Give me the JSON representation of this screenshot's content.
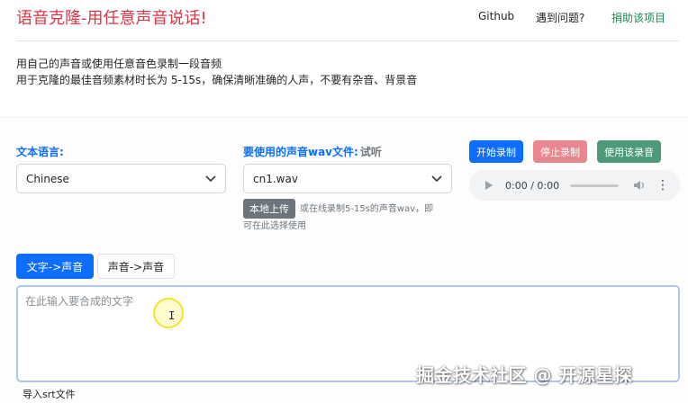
{
  "header": {
    "brand": "语音克隆-用任意声音说话!",
    "nav": {
      "github": "Github",
      "issue": "遇到问题?",
      "donate": "捐助该项目"
    }
  },
  "intro": {
    "line1": "用自己的声音或使用任意音色录制一段音频",
    "line2": "用于克隆的最佳音频素材时长为 5-15s，确保清晰准确的人声，不要有杂音、背景音"
  },
  "form": {
    "language_label": "文本语言:",
    "language_value": "Chinese",
    "wav_label": "要使用的声音wav文件:",
    "wav_listen": "试听",
    "wav_value": "cn1.wav",
    "upload_button": "本地上传",
    "upload_hint_1": "或在线录制5-15s的声音wav，即",
    "upload_hint_2": "可在此选择使用"
  },
  "recorder": {
    "start": "开始录制",
    "stop": "停止录制",
    "use": "使用该录音",
    "time": "0:00 / 0:00"
  },
  "tabs": {
    "text_to_voice": "文字->声音",
    "voice_to_voice": "声音->声音"
  },
  "textarea": {
    "placeholder": "在此输入要合成的文字"
  },
  "footer": {
    "import_srt": "导入srt文件"
  },
  "watermark": "掘金技术社区 @ 开源星探",
  "colors": {
    "brand": "#dc3545",
    "primary": "#0d6efd",
    "danger_light": "#ea868f",
    "success": "#4d9a7a",
    "secondary": "#6c757d"
  }
}
